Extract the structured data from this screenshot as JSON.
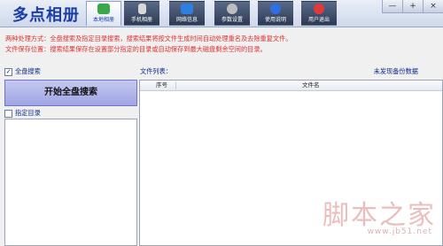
{
  "app": {
    "title": "多点相册"
  },
  "tabs": [
    {
      "label": "本地相册",
      "icon": "photo-icon",
      "color": "#3aa84a"
    },
    {
      "label": "手机相册",
      "icon": "phone-icon",
      "color": "#d8d8d8"
    },
    {
      "label": "网络信息",
      "icon": "network-icon",
      "color": "#2d7fe0"
    },
    {
      "label": "参数设置",
      "icon": "gear-icon",
      "color": "#bdbdbd"
    },
    {
      "label": "使用说明",
      "icon": "help-icon",
      "color": "#2f6fe4"
    },
    {
      "label": "用户退出",
      "icon": "power-icon",
      "color": "#e03a3a"
    }
  ],
  "window_buttons": [
    "—",
    "+",
    "×"
  ],
  "info": {
    "line1": "两种处理方式：全盘搜索及指定目录搜索，搜索结果将按文件生成时间自动处理重名及去除重复文件。",
    "line2": "文件保存位置：搜索结果保存在设置部分指定的目录或自动保存到最大磁盘剩余空间的目录。"
  },
  "options": {
    "full_search_label": "全盘搜索",
    "full_search_checked": true,
    "specify_dir_label": "指定目录",
    "specify_dir_checked": false
  },
  "start_button": "开始全盘搜索",
  "file_list": {
    "label": "文件列表：",
    "status": "未发现备份数据",
    "columns": [
      "序号",
      "文件名"
    ],
    "rows": []
  },
  "watermark": {
    "text": "脚本之家",
    "url": "www.jb51.net"
  }
}
